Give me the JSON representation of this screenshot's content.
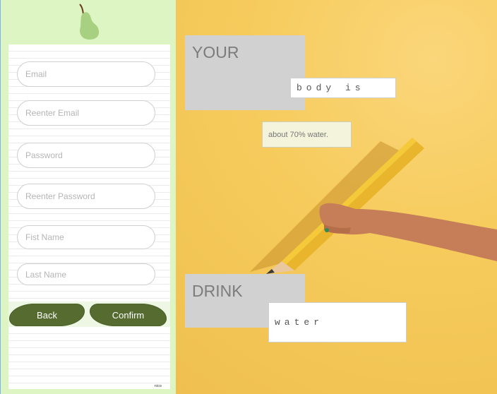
{
  "form": {
    "fields": [
      {
        "placeholder": "Email"
      },
      {
        "placeholder": "Reenter Email"
      },
      {
        "placeholder": "Password"
      },
      {
        "placeholder": "Reenter Password"
      },
      {
        "placeholder": "Fist Name"
      },
      {
        "placeholder": "Last Name"
      }
    ],
    "back_label": "Back",
    "confirm_label": "Confirm",
    "watermark": "nico"
  },
  "hero": {
    "heading_1": "YOUR",
    "tag_1": "body is",
    "note": "about 70% water.",
    "heading_2": "DRINK",
    "tag_2": "water"
  },
  "colors": {
    "sidebar_bg": "#ddf5c3",
    "button_green": "#556b30",
    "hero_yellow": "#f6cb5c",
    "grey_block": "#d1d1d1"
  },
  "icons": {
    "logo": "pear-icon"
  }
}
